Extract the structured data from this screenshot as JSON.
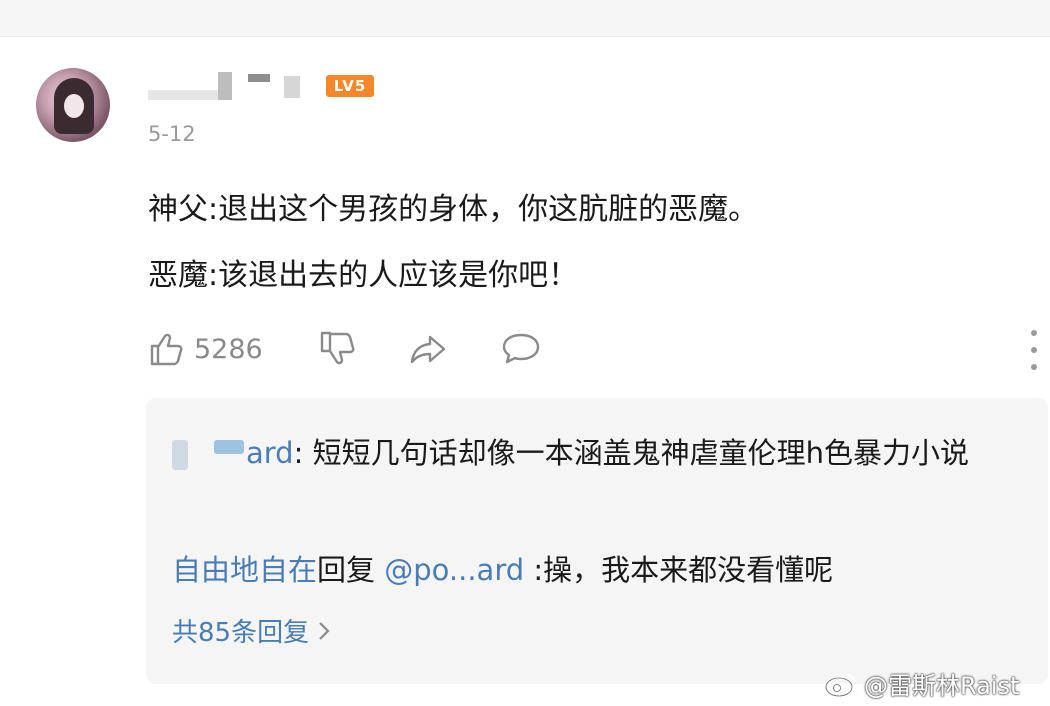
{
  "comment": {
    "level_badge": "LV5",
    "date": "5-12",
    "text_line1": "神父:退出这个男孩的身体，你这肮脏的恶魔。",
    "text_line2": "恶魔:该退出去的人应该是你吧！",
    "like_count": "5286",
    "icons": [
      "thumbs-up-icon",
      "thumbs-down-icon",
      "share-icon",
      "comment-icon",
      "more-icon"
    ]
  },
  "replies": {
    "reply1": {
      "nick_visible": "ard",
      "text": ": 短短几句话却像一本涵盖鬼神虐童伦理h色暴力小说"
    },
    "reply2": {
      "nick_visible": "自由地自在",
      "action": "回复",
      "mention": "@po...ard",
      "text": " :操，我本来都没看懂呢"
    },
    "total": "共85条回复"
  },
  "watermark": "@雷斯林Raist",
  "colors": {
    "link": "#4a7db5",
    "badge": "#f5862a",
    "reply_bg": "#f5f5f5",
    "secondary_text": "#8a8a8a"
  }
}
